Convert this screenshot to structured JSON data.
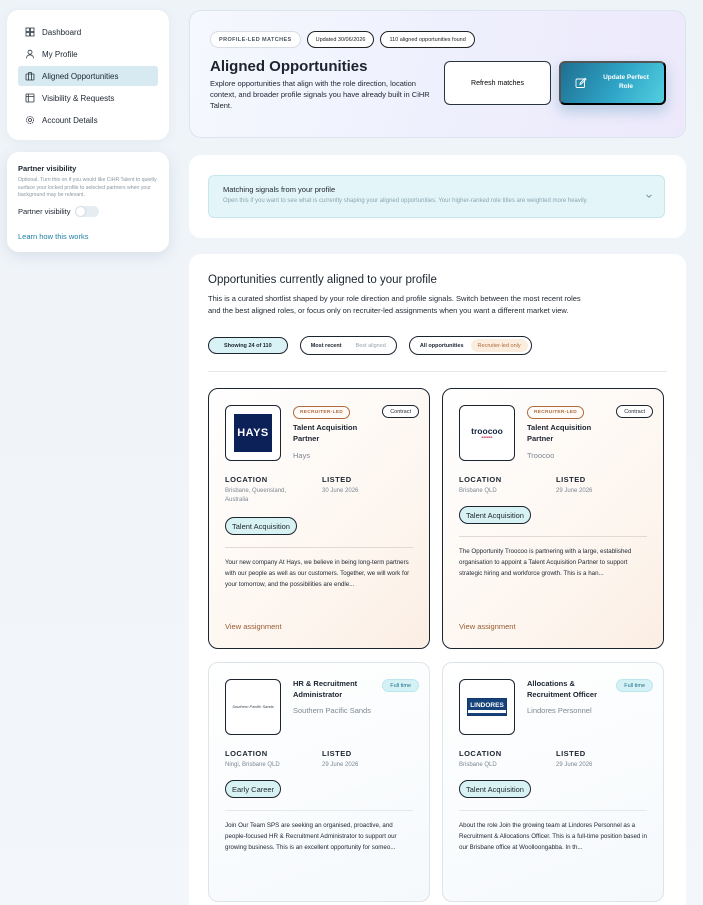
{
  "sidebar": {
    "items": [
      {
        "label": "Dashboard",
        "icon": "dashboard-icon",
        "active": false
      },
      {
        "label": "My Profile",
        "icon": "user-icon",
        "active": false
      },
      {
        "label": "Aligned Opportunities",
        "icon": "briefcase-icon",
        "active": true
      },
      {
        "label": "Visibility & Requests",
        "icon": "list-icon",
        "active": false
      },
      {
        "label": "Account Details",
        "icon": "gear-icon",
        "active": false
      }
    ]
  },
  "partner": {
    "title": "Partner visibility",
    "description": "Optional. Turn this on if you would like CiHR Talent to quietly surface your locked profile to selected partners when your background may be relevant.",
    "toggle_label": "Partner visibility",
    "enabled": false,
    "learn_link": "Learn how this works"
  },
  "hero": {
    "pill_type": "PROFILE-LED MATCHES",
    "pill_updated": "Updated 30/06/2026",
    "pill_found": "110 aligned opportunities found",
    "title": "Aligned Opportunities",
    "description": "Explore opportunities that align with the role direction, location context, and broader profile signals you have already built in CiHR Talent.",
    "refresh_label": "Refresh matches",
    "update_label": "Update Perfect Role"
  },
  "signals": {
    "title": "Matching signals from your profile",
    "subtitle": "Open this if you want to see what is currently shaping your aligned opportunities. Your higher-ranked role titles are weighted more heavily."
  },
  "opportunities": {
    "title": "Opportunities currently aligned to your profile",
    "lead": "This is a curated shortlist shaped by your role direction and profile signals. Switch between the most recent roles and the best aligned roles, or focus only on recruiter-led assignments when you want a different market view.",
    "showing": "Showing 24 of 110",
    "sort_options": [
      "Most recent",
      "Best aligned"
    ],
    "filter_options": [
      "All opportunities",
      "Recruiter-led only"
    ],
    "location_label": "LOCATION",
    "listed_label": "LISTED",
    "cards": [
      {
        "recruiter_badge": "RECRUITER-LED",
        "type": "Contract",
        "role": "Talent Acquisition Partner",
        "company": "Hays",
        "logo_text": "HAYS",
        "location": "Brisbane, Queensland, Australia",
        "listed": "30 June 2026",
        "tag": "Talent Acquisition",
        "excerpt": "Your new company At Hays, we believe in being long-term partners with our people as well as our customers. Together, we will work for your tomorrow, and the possibilities are endle...",
        "link": "View assignment"
      },
      {
        "recruiter_badge": "RECRUITER-LED",
        "type": "Contract",
        "role": "Talent Acquisition Partner",
        "company": "Troocoo",
        "logo_text": "troocoo",
        "location": "Brisbane QLD",
        "listed": "29 June 2026",
        "tag": "Talent Acquisition",
        "excerpt": "The Opportunity Troocoo is partnering with a large, established organisation to appoint a Talent Acquisition Partner to support strategic hiring and workforce growth. This is a han...",
        "link": "View assignment"
      },
      {
        "type": "Full time",
        "role": "HR & Recruitment Administrator",
        "company": "Southern Pacific Sands",
        "logo_text": "Southern Pacific Sands",
        "location": "Ningi, Brisbane QLD",
        "listed": "29 June 2026",
        "tag": "Early Career",
        "excerpt": "Join Our Team SPS are seeking an organised, proactive, and people-focused HR & Recruitment Administrator to support our growing business. This is an excellent opportunity for someo..."
      },
      {
        "type": "Full time",
        "role": "Allocations & Recruitment Officer",
        "company": "Lindores Personnel",
        "logo_text": "LINDORES",
        "location": "Brisbane QLD",
        "listed": "29 June 2026",
        "tag": "Talent Acquisition",
        "excerpt": "About the role Join the growing team at Lindores Personnel as a Recruitment & Allocations Officer. This is a full-time position based in our Brisbane office at Woolloongabba. In th..."
      }
    ]
  },
  "colors": {
    "accent": "#2fa5c7",
    "recruiter": "#b06a3e",
    "active_nav": "#d7eaf2"
  }
}
